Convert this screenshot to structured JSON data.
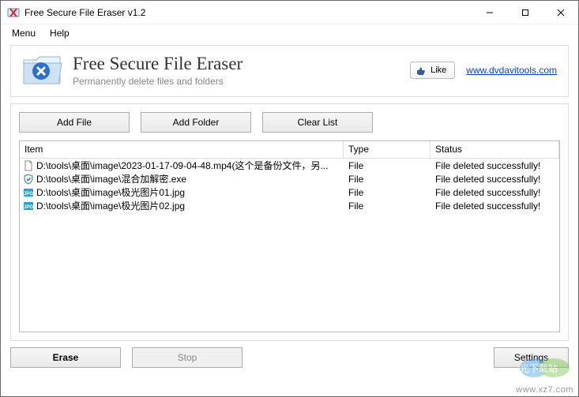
{
  "window": {
    "title": "Free Secure File Eraser v1.2"
  },
  "menubar": {
    "menu": "Menu",
    "help": "Help"
  },
  "header": {
    "title": "Free Secure File Eraser",
    "subtitle": "Permanently delete files and folders",
    "like_label": "Like",
    "site_url": "www.dvdavitools.com"
  },
  "buttons": {
    "add_file": "Add File",
    "add_folder": "Add Folder",
    "clear_list": "Clear List",
    "erase": "Erase",
    "stop": "Stop",
    "settings": "Settings"
  },
  "columns": {
    "item": "Item",
    "type": "Type",
    "status": "Status"
  },
  "rows": [
    {
      "icon": "page",
      "item": "D:\\tools\\桌面\\image\\2023-01-17-09-04-48.mp4(这个是备份文件，另...",
      "type": "File",
      "status": "File deleted successfully!"
    },
    {
      "icon": "shield",
      "item": "D:\\tools\\桌面\\image\\混合加解密.exe",
      "type": "File",
      "status": "File deleted successfully!"
    },
    {
      "icon": "jpg",
      "item": "D:\\tools\\桌面\\image\\极光图片01.jpg",
      "type": "File",
      "status": "File deleted successfully!"
    },
    {
      "icon": "jpg",
      "item": "D:\\tools\\桌面\\image\\极光图片02.jpg",
      "type": "File",
      "status": "File deleted successfully!"
    }
  ],
  "watermark": {
    "brand": "极光下载站",
    "url": "www.xz7.com"
  }
}
